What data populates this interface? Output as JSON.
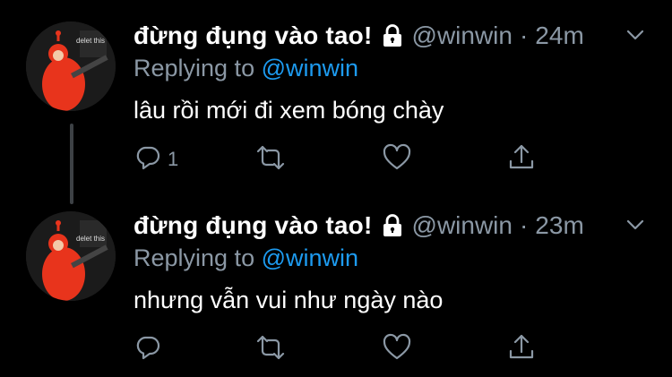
{
  "tweets": [
    {
      "avatar_caption": "delet this",
      "display_name": "đừng đụng vào tao!",
      "handle": "@winwin",
      "separator": "·",
      "time": "24m",
      "replying_prefix": "Replying to ",
      "replying_mention": "@winwin",
      "text": "lâu rồi mới đi xem bóng chày",
      "reply_count": "1"
    },
    {
      "avatar_caption": "delet this",
      "display_name": "đừng đụng vào tao!",
      "handle": "@winwin",
      "separator": "·",
      "time": "23m",
      "replying_prefix": "Replying to ",
      "replying_mention": "@winwin",
      "text": "nhưng vẫn vui như ngày nào",
      "reply_count": ""
    }
  ],
  "icons": {
    "lock": "lock-icon",
    "menu": "chevron-down-icon",
    "reply": "reply-icon",
    "retweet": "retweet-icon",
    "like": "heart-icon",
    "share": "share-icon"
  },
  "colors": {
    "background": "#000000",
    "text": "#ffffff",
    "muted": "#8b98a5",
    "link": "#1d9bf0",
    "thread_line": "#3d4145"
  }
}
